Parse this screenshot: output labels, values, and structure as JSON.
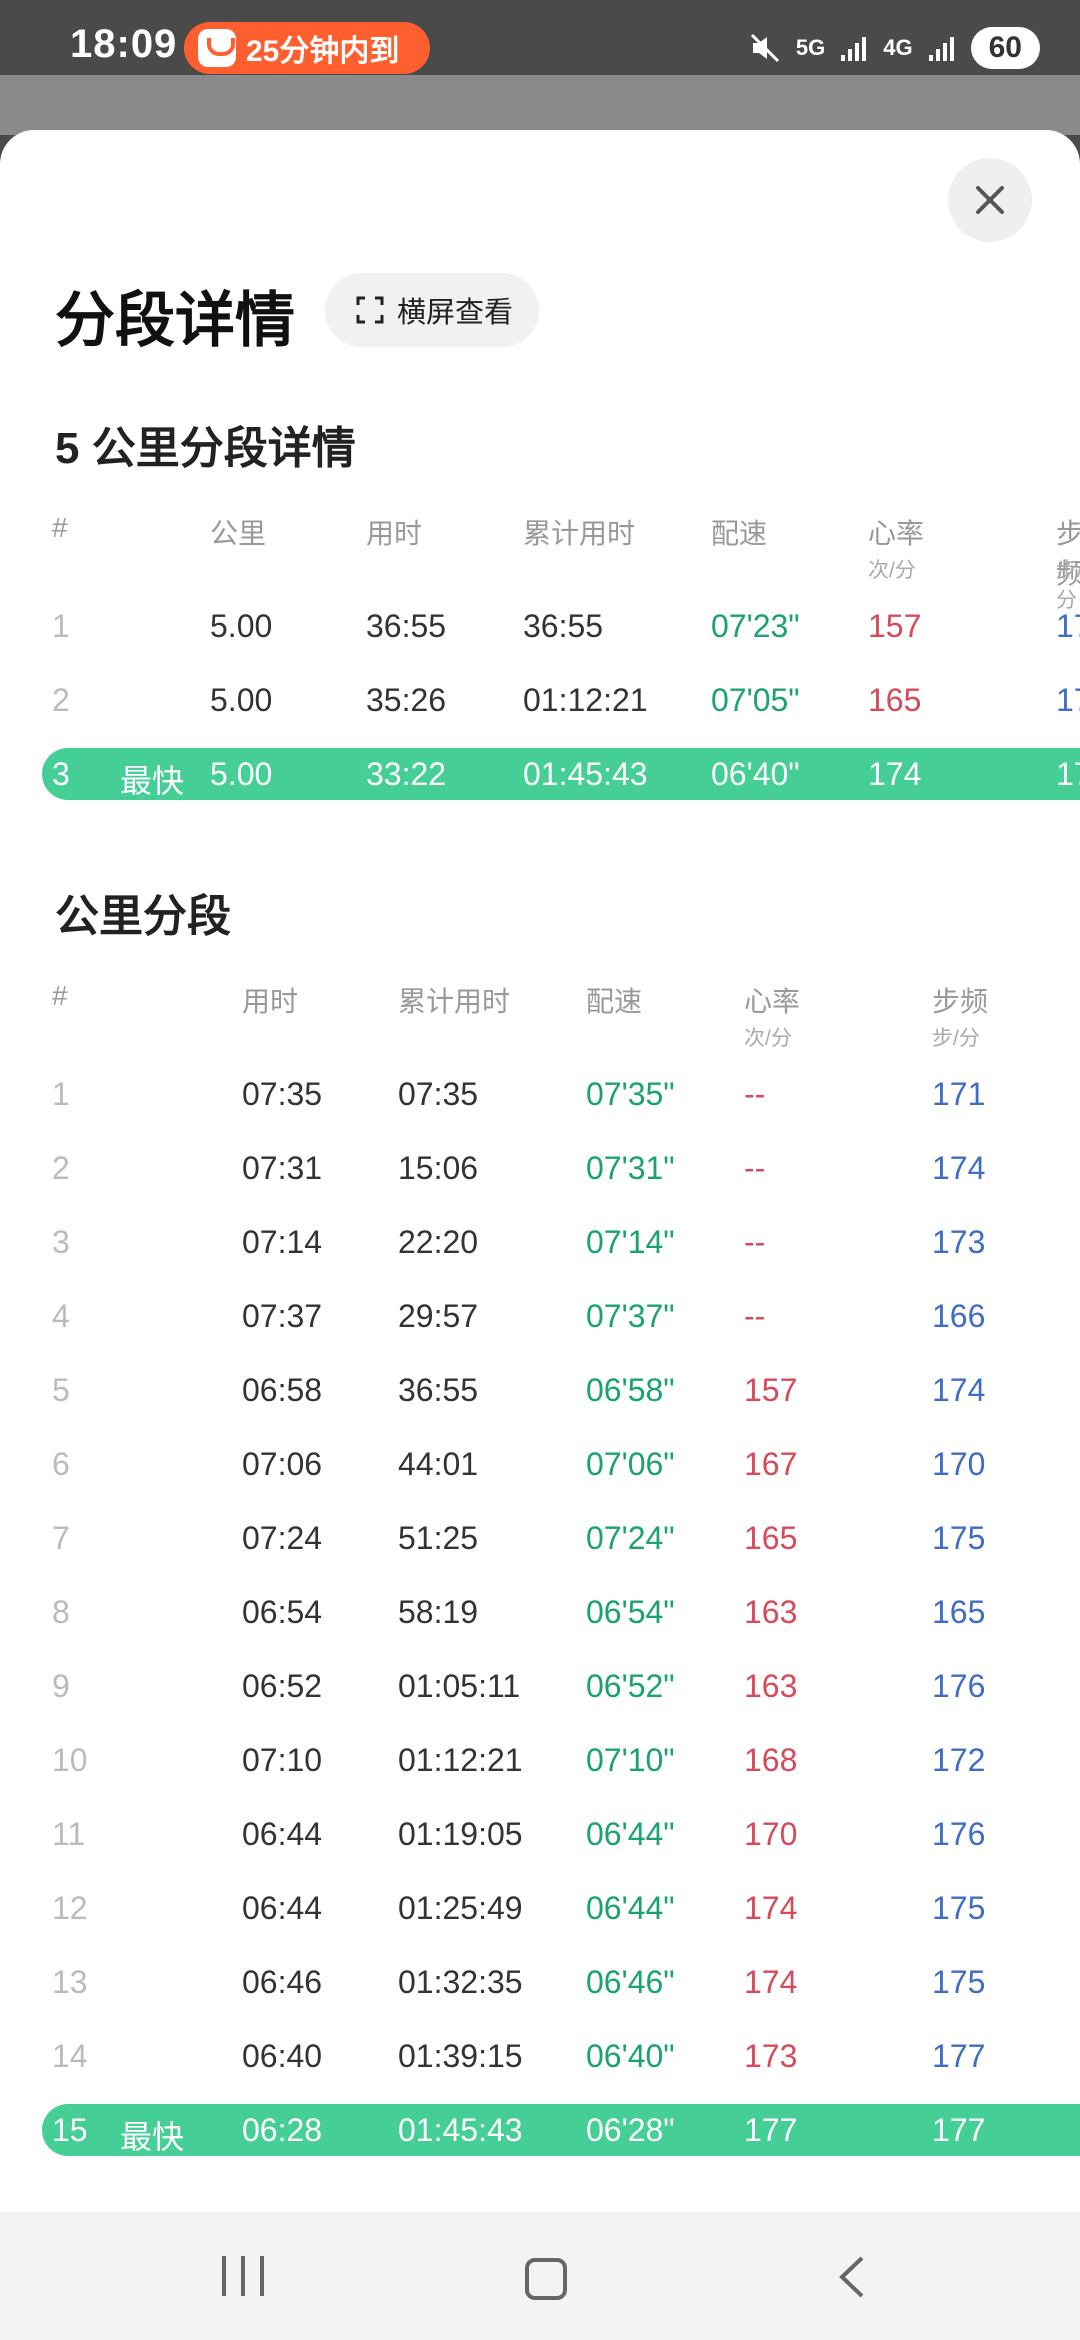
{
  "status": {
    "time": "18:09",
    "promo_text": "25分钟内到",
    "network_1": "5G",
    "network_2": "4G",
    "battery": "60"
  },
  "sheet": {
    "title": "分段详情",
    "landscape_label": "横屏查看"
  },
  "five_km": {
    "title": "5 公里分段详情",
    "headers": [
      "#",
      "公里",
      "用时",
      "累计用时",
      "配速",
      "心率",
      "步频"
    ],
    "hr_unit": "次/分",
    "cad_unit": "步/分",
    "rows": [
      {
        "idx": "1",
        "badge": "",
        "km": "5.00",
        "time": "36:55",
        "cum": "36:55",
        "pace": "07'23\"",
        "hr": "157",
        "cad": "17"
      },
      {
        "idx": "2",
        "badge": "",
        "km": "5.00",
        "time": "35:26",
        "cum": "01:12:21",
        "pace": "07'05\"",
        "hr": "165",
        "cad": "17"
      },
      {
        "idx": "3",
        "badge": "最快",
        "km": "5.00",
        "time": "33:22",
        "cum": "01:45:43",
        "pace": "06'40\"",
        "hr": "174",
        "cad": "17"
      }
    ]
  },
  "per_km": {
    "title": "公里分段",
    "headers": [
      "#",
      "用时",
      "累计用时",
      "配速",
      "心率",
      "步频"
    ],
    "hr_unit": "次/分",
    "cad_unit": "步/分",
    "rows": [
      {
        "idx": "1",
        "badge": "",
        "time": "07:35",
        "cum": "07:35",
        "pace": "07'35\"",
        "hr": "--",
        "cad": "171"
      },
      {
        "idx": "2",
        "badge": "",
        "time": "07:31",
        "cum": "15:06",
        "pace": "07'31\"",
        "hr": "--",
        "cad": "174"
      },
      {
        "idx": "3",
        "badge": "",
        "time": "07:14",
        "cum": "22:20",
        "pace": "07'14\"",
        "hr": "--",
        "cad": "173"
      },
      {
        "idx": "4",
        "badge": "",
        "time": "07:37",
        "cum": "29:57",
        "pace": "07'37\"",
        "hr": "--",
        "cad": "166"
      },
      {
        "idx": "5",
        "badge": "",
        "time": "06:58",
        "cum": "36:55",
        "pace": "06'58\"",
        "hr": "157",
        "cad": "174"
      },
      {
        "idx": "6",
        "badge": "",
        "time": "07:06",
        "cum": "44:01",
        "pace": "07'06\"",
        "hr": "167",
        "cad": "170"
      },
      {
        "idx": "7",
        "badge": "",
        "time": "07:24",
        "cum": "51:25",
        "pace": "07'24\"",
        "hr": "165",
        "cad": "175"
      },
      {
        "idx": "8",
        "badge": "",
        "time": "06:54",
        "cum": "58:19",
        "pace": "06'54\"",
        "hr": "163",
        "cad": "165"
      },
      {
        "idx": "9",
        "badge": "",
        "time": "06:52",
        "cum": "01:05:11",
        "pace": "06'52\"",
        "hr": "163",
        "cad": "176"
      },
      {
        "idx": "10",
        "badge": "",
        "time": "07:10",
        "cum": "01:12:21",
        "pace": "07'10\"",
        "hr": "168",
        "cad": "172"
      },
      {
        "idx": "11",
        "badge": "",
        "time": "06:44",
        "cum": "01:19:05",
        "pace": "06'44\"",
        "hr": "170",
        "cad": "176"
      },
      {
        "idx": "12",
        "badge": "",
        "time": "06:44",
        "cum": "01:25:49",
        "pace": "06'44\"",
        "hr": "174",
        "cad": "175"
      },
      {
        "idx": "13",
        "badge": "",
        "time": "06:46",
        "cum": "01:32:35",
        "pace": "06'46\"",
        "hr": "174",
        "cad": "175"
      },
      {
        "idx": "14",
        "badge": "",
        "time": "06:40",
        "cum": "01:39:15",
        "pace": "06'40\"",
        "hr": "173",
        "cad": "177"
      },
      {
        "idx": "15",
        "badge": "最快",
        "time": "06:28",
        "cum": "01:45:43",
        "pace": "06'28\"",
        "hr": "177",
        "cad": "177"
      }
    ]
  },
  "colors": {
    "highlight": "#45cf97",
    "pace": "#1aa36d",
    "heart_rate": "#d64a5a",
    "cadence": "#3f6dc6"
  }
}
